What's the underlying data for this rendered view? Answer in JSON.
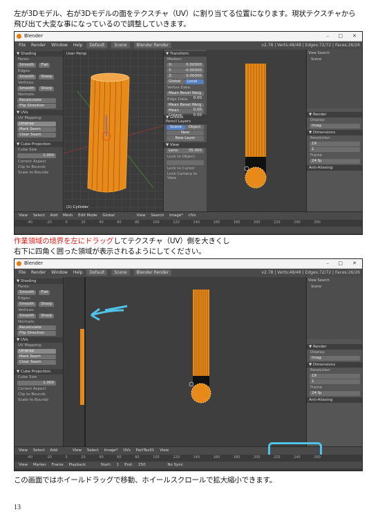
{
  "text": {
    "para1": "左が3Dモデル、右が3Dモデルの面をテクスチャ（UV）に割り当てる位置になります。現状テクスチャから飛び出て大変な事になっているので調整していきます。",
    "para2_red": "作業領域の境界を左にドラッグ",
    "para2_rest": "してテクスチャ（UV）側を大きくし",
    "para2_line2": "右下に四角く囲った領域が表示されるようにしてください。",
    "para3": "この画面ではホイールドラッグで移動、ホイールスクロールで拡大縮小できます。",
    "page_number": "13"
  },
  "shot1": {
    "window_title": "Blender",
    "win_controls": [
      "–",
      "□",
      "✕"
    ],
    "menu": [
      "File",
      "Render",
      "Window",
      "Help"
    ],
    "layout_field": "Default",
    "scene_field": "Scene",
    "engine_field": "Blender Render",
    "stats": "v2.78 | Verts:48/48 | Edges:72/72 | Faces:26/26",
    "left_panel": {
      "shading_header": "▼ Shading",
      "faces": "Faces:",
      "smooth": "Smooth",
      "flat": "Flat",
      "edges": "Edges:",
      "vertices": "Vertices:",
      "sharp": "Sharp",
      "normals": "Normals:",
      "recalculate": "Recalculate",
      "flip_direction": "Flip Direction",
      "uvs_header": "▼ UVs",
      "uv_mapping": "UV Mapping:",
      "unwrap": "Unwrap",
      "mark_seam": "Mark Seam",
      "clear_seam": "Clear Seam",
      "cube_projection": "▼ Cube Projection",
      "cube_size": "Cube Size",
      "cube_size_value": "1.000",
      "correct_aspect": "Correct Aspect",
      "clip_to_bounds": "Clip to Bounds",
      "scale_to_bounds": "Scale to Bounds"
    },
    "viewport_label": "User Persp",
    "object_label": "(1) Cylinder",
    "transform": {
      "header": "▼ Transform",
      "median": "Median:",
      "x": "X:",
      "x_val": "0.00000",
      "y": "Y:",
      "y_val": "-0.00000",
      "z": "Z:",
      "z_val": "0.00000",
      "global": "Global",
      "local": "Local",
      "vertex_data": "Vertex Data:",
      "mean_bevel_weight": "Mean Bevel Weig",
      "mbw_val": "0.00",
      "edge_data": "Edge Data:",
      "mean_crease": "Mean Crease:",
      "mc_val": "0.00",
      "grease_pencil": "▼ Grease Pencil Layers",
      "scene": "Scene",
      "object": "Object",
      "new": "New",
      "new_layer": "New Layer",
      "view_header": "▼ View",
      "lens": "Lens:",
      "lens_val": "35.000",
      "lock_to_object": "Lock to Object:",
      "lock_to_cursor": "Lock to Cursor",
      "lock_camera": "Lock Camera to View"
    },
    "status": [
      "View",
      "Select",
      "Add",
      "Mesh",
      "Edit Mode",
      "Global",
      "View",
      "Search",
      "Image*",
      "UVs"
    ],
    "timeline_numbers": [
      "-40",
      "-20",
      "0",
      "20",
      "40",
      "60",
      "80",
      "100",
      "120",
      "140",
      "160",
      "180",
      "200",
      "220",
      "240",
      "260"
    ],
    "props": {
      "view": "View",
      "search": "Search",
      "scene": "Scene",
      "render": "▼ Render",
      "dimensions": "▼ Dimensions",
      "resolution": "Resolution",
      "frame_range": "Frame",
      "anti_aliasing": "Anti-Aliasing",
      "val_19": "19",
      "val_1": "1",
      "val_24": "24 fp",
      "display": "Display:",
      "image_editor": "Imag"
    }
  },
  "shot2": {
    "window_title": "Blender",
    "win_controls": [
      "–",
      "□",
      "✕"
    ],
    "menu": [
      "File",
      "Render",
      "Window",
      "Help"
    ],
    "layout_field": "Default",
    "scene_field": "Scene",
    "engine_field": "Blender Render",
    "stats": "v2.78 | Verts:48/48 | Edges:72/72 | Faces:26/26",
    "status": [
      "View",
      "Select",
      "Add",
      "View",
      "Select",
      "Image*",
      "UVs",
      "PartTex01",
      "View"
    ],
    "timeline_bottom": [
      "View",
      "Marker",
      "Frame",
      "Playback",
      "Start:",
      "1",
      "End:",
      "250",
      "No Sync"
    ],
    "start_label": "Start:",
    "start_val": "1",
    "end_label": "End:",
    "end_val": "250",
    "nosync": "No Sync",
    "highlight_color": "#4fc3e8",
    "arrow_color": "#4fc3e8"
  },
  "colors": {
    "orange": "#e88a1a",
    "red_text": "#e0201a",
    "blender_bg": "#3a3a3a"
  }
}
